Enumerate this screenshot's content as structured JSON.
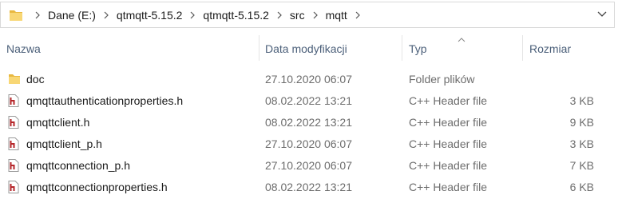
{
  "breadcrumb": {
    "items": [
      "Dane (E:)",
      "qtmqtt-5.15.2",
      "qtmqtt-5.15.2",
      "src",
      "mqtt"
    ]
  },
  "columns": {
    "name": "Nazwa",
    "date": "Data modyfikacji",
    "type": "Typ",
    "size": "Rozmiar"
  },
  "files": [
    {
      "name": "doc",
      "date": "27.10.2020 06:07",
      "type": "Folder plików",
      "size": "",
      "icon": "folder-icon"
    },
    {
      "name": "qmqttauthenticationproperties.h",
      "date": "08.02.2022 13:21",
      "type": "C++ Header file",
      "size": "3 KB",
      "icon": "header-file-icon"
    },
    {
      "name": "qmqttclient.h",
      "date": "08.02.2022 13:21",
      "type": "C++ Header file",
      "size": "9 KB",
      "icon": "header-file-icon"
    },
    {
      "name": "qmqttclient_p.h",
      "date": "27.10.2020 06:07",
      "type": "C++ Header file",
      "size": "3 KB",
      "icon": "header-file-icon"
    },
    {
      "name": "qmqttconnection_p.h",
      "date": "27.10.2020 06:07",
      "type": "C++ Header file",
      "size": "7 KB",
      "icon": "header-file-icon"
    },
    {
      "name": "qmqttconnectionproperties.h",
      "date": "08.02.2022 13:21",
      "type": "C++ Header file",
      "size": "6 KB",
      "icon": "header-file-icon"
    }
  ],
  "colors": {
    "folder": "#f8d775",
    "header_icon_accent": "#b5262a",
    "column_header_text": "#4c607a"
  }
}
